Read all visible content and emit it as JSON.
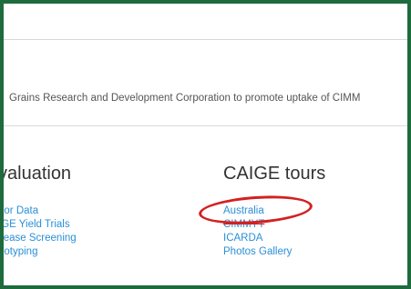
{
  "intro_text": "Grains Research and Development Corporation to promote uptake of CIMM",
  "left_section": {
    "heading": "valuation",
    "links": [
      "nor Data",
      "IGE Yield Trials",
      "sease Screening",
      "notyping"
    ]
  },
  "right_section": {
    "heading": "CAIGE tours",
    "links": [
      "Australia",
      "CIMMYT",
      "ICARDA",
      "Photos Gallery"
    ]
  },
  "colors": {
    "frame_border": "#1e6b3e",
    "link": "#2a8fd8",
    "annotation": "#d42020"
  }
}
